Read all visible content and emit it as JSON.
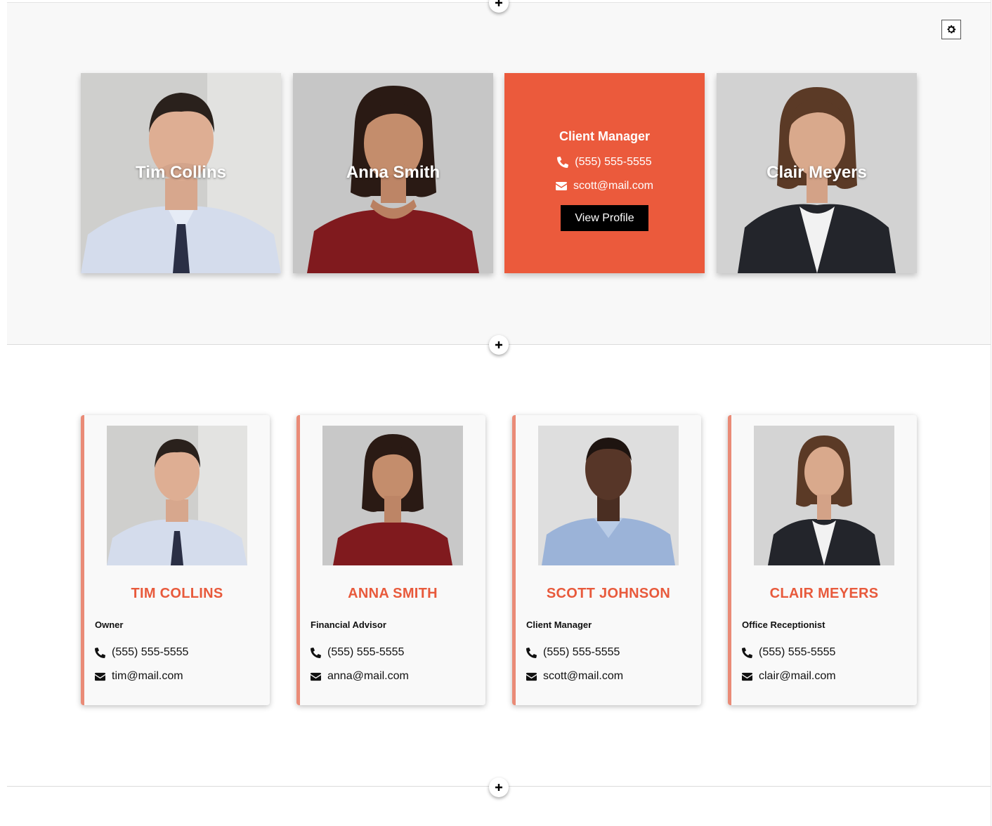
{
  "colors": {
    "accent": "#eb5a3c",
    "accent_text": "#e85a3c",
    "card_border": "#ea8b77",
    "button": "#000000"
  },
  "top_cards": [
    {
      "name": "Tim Collins"
    },
    {
      "name": "Anna Smith"
    },
    {
      "role": "Client Manager",
      "phone": "(555) 555-5555",
      "email": "scott@mail.com",
      "button_label": "View Profile"
    },
    {
      "name": "Clair Meyers"
    }
  ],
  "bottom_cards": [
    {
      "name": "TIM COLLINS",
      "role": "Owner",
      "phone": "(555) 555-5555",
      "email": "tim@mail.com"
    },
    {
      "name": "ANNA SMITH",
      "role": "Financial Advisor",
      "phone": "(555) 555-5555",
      "email": "anna@mail.com"
    },
    {
      "name": "SCOTT JOHNSON",
      "role": "Client Manager",
      "phone": "(555) 555-5555",
      "email": "scott@mail.com"
    },
    {
      "name": "CLAIR MEYERS",
      "role": "Office Receptionist",
      "phone": "(555) 555-5555",
      "email": "clair@mail.com"
    }
  ],
  "icons": {
    "add": "plus-icon",
    "settings": "gear-icon",
    "phone": "phone-icon",
    "email": "envelope-icon"
  }
}
